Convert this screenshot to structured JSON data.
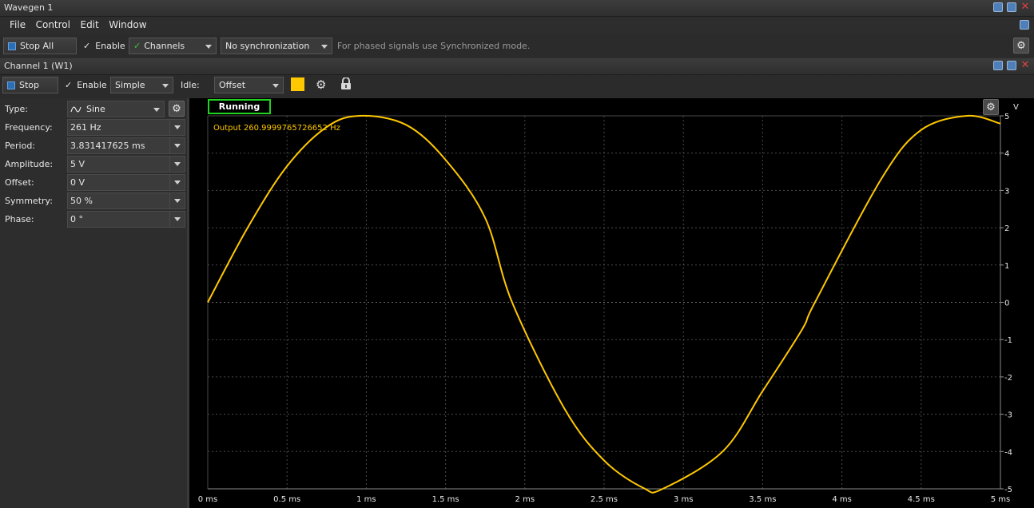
{
  "window": {
    "title": "Wavegen 1"
  },
  "menu": [
    "File",
    "Control",
    "Edit",
    "Window"
  ],
  "toolbar": {
    "stop_all_label": "Stop All",
    "enable_label": "Enable",
    "channels_label": "Channels",
    "sync_value": "No synchronization",
    "sync_hint": "For phased signals use Synchronized mode."
  },
  "channel": {
    "title": "Channel 1 (W1)",
    "stop_label": "Stop",
    "enable_label": "Enable",
    "mode_value": "Simple",
    "idle_label": "Idle:",
    "idle_value": "Offset",
    "color": "#ffc800"
  },
  "params": [
    {
      "label": "Type:",
      "value": "Sine",
      "icon": "sine-wave-icon"
    },
    {
      "label": "Frequency:",
      "value": "261 Hz"
    },
    {
      "label": "Period:",
      "value": "3.831417625 ms"
    },
    {
      "label": "Amplitude:",
      "value": "5 V"
    },
    {
      "label": "Offset:",
      "value": "0 V"
    },
    {
      "label": "Symmetry:",
      "value": "50 %"
    },
    {
      "label": "Phase:",
      "value": "0 °"
    }
  ],
  "plot": {
    "status": "Running",
    "output_text": "Output 260.9999765726652 Hz",
    "y_unit": "V",
    "status_color": "#21d321"
  },
  "chart_data": {
    "type": "line",
    "title": "",
    "xlabel": "",
    "ylabel": "V",
    "xlim": [
      0,
      5
    ],
    "ylim": [
      -5,
      5
    ],
    "x_ticks": [
      "0 ms",
      "0.5 ms",
      "1 ms",
      "1.5 ms",
      "2 ms",
      "2.5 ms",
      "3 ms",
      "3.5 ms",
      "4 ms",
      "4.5 ms",
      "5 ms"
    ],
    "y_ticks": [
      "5",
      "4",
      "3",
      "2",
      "1",
      "0",
      "-1",
      "-2",
      "-3",
      "-4",
      "-5"
    ],
    "grid": true,
    "series": [
      {
        "color": "#ffc800",
        "x_unit": "ms",
        "x": [
          0,
          0.25,
          0.5,
          0.75,
          0.96,
          1.25,
          1.5,
          1.75,
          1.92,
          2.25,
          2.5,
          2.75,
          2.87,
          3.25,
          3.5,
          3.75,
          3.83,
          4.25,
          4.5,
          4.79,
          5
        ],
        "y": [
          0,
          1.99,
          3.65,
          4.7,
          5,
          4.76,
          3.82,
          2.26,
          0,
          -2.85,
          -4.24,
          -4.98,
          -5,
          -3.99,
          -2.38,
          -0.72,
          0,
          3.32,
          4.62,
          5,
          4.79
        ]
      }
    ]
  }
}
